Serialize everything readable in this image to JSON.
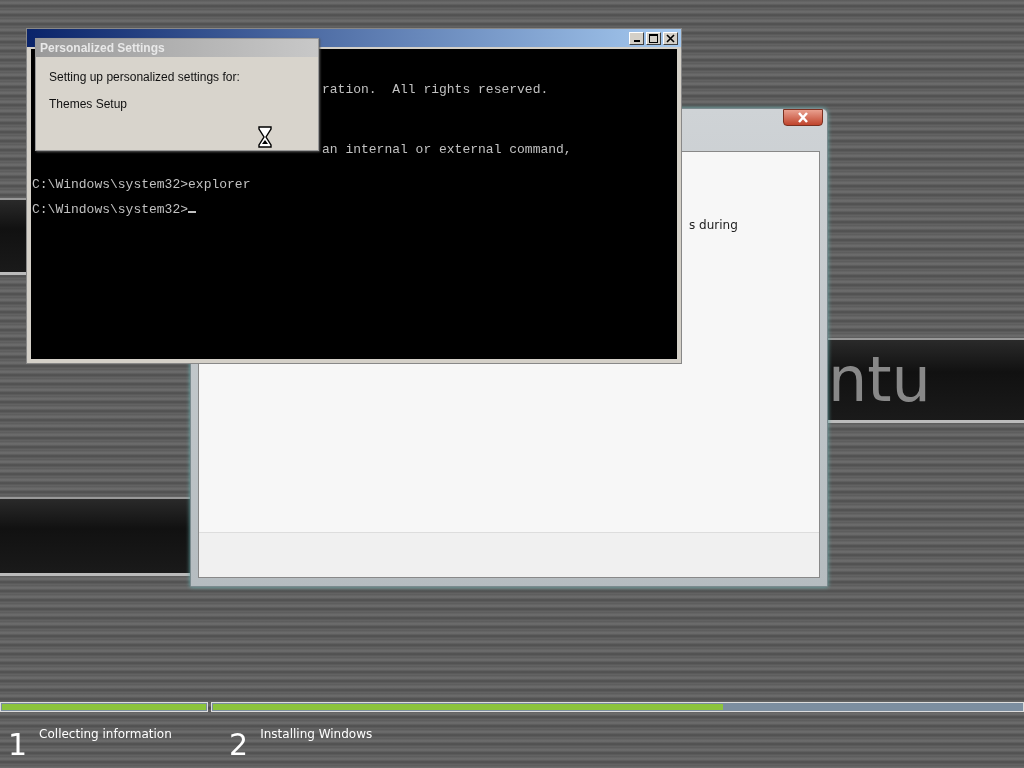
{
  "wallpaper": {
    "logo_text": "ntu"
  },
  "setup_window": {
    "text": "s during"
  },
  "cmd_window": {
    "lines": [
      {
        "text": "ration.  All rights reserved.",
        "kind": "cut"
      },
      {
        "text": "an internal or external command,",
        "kind": "cut"
      },
      {
        "text": "C:\\Windows\\system32>explorer",
        "kind": "full"
      },
      {
        "text": "C:\\Windows\\system32>",
        "kind": "prompt"
      }
    ]
  },
  "dialog": {
    "title": "Personalized Settings",
    "message": "Setting up personalized settings for:",
    "item": "Themes Setup"
  },
  "progress": [
    {
      "level": 1
    },
    {
      "level": 0.63
    }
  ],
  "steps": [
    {
      "number": "1",
      "label": "Collecting information"
    },
    {
      "number": "2",
      "label": "Installing Windows"
    }
  ]
}
